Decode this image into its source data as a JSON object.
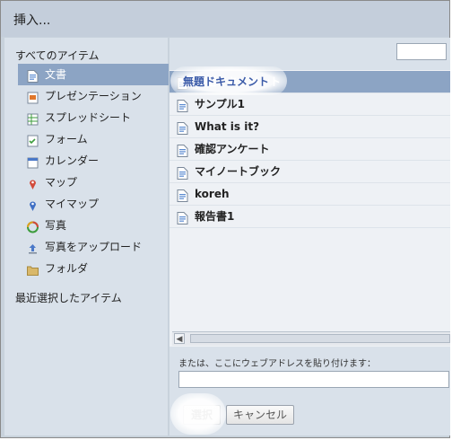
{
  "dialog": {
    "title": "挿入..."
  },
  "sidebar": {
    "all_items_heading": "すべてのアイテム",
    "items": [
      {
        "label": "文書",
        "icon": "document-icon",
        "color": "#5b8bd1"
      },
      {
        "label": "プレゼンテーション",
        "icon": "presentation-icon",
        "color": "#e0762a"
      },
      {
        "label": "スプレッドシート",
        "icon": "spreadsheet-icon",
        "color": "#3c9c3c"
      },
      {
        "label": "フォーム",
        "icon": "form-icon",
        "color": "#3c9c3c"
      },
      {
        "label": "カレンダー",
        "icon": "calendar-icon",
        "color": "#4a78c8"
      },
      {
        "label": "マップ",
        "icon": "map-pin-icon",
        "color": "#d24a3a"
      },
      {
        "label": "マイマップ",
        "icon": "my-map-pin-icon",
        "color": "#3f6fc4"
      },
      {
        "label": "写真",
        "icon": "photo-icon",
        "color": "#e0a020"
      },
      {
        "label": "写真をアップロード",
        "icon": "upload-icon",
        "color": "#4a78c8"
      },
      {
        "label": "フォルダ",
        "icon": "folder-icon",
        "color": "#d9b86a"
      }
    ],
    "recent_heading": "最近選択したアイテム"
  },
  "documents": [
    {
      "name": "無題ドキュメント",
      "selected": true
    },
    {
      "name": "サンプル1",
      "selected": false
    },
    {
      "name": "What is it?",
      "selected": false
    },
    {
      "name": "確認アンケート",
      "selected": false
    },
    {
      "name": "マイノートブック",
      "selected": false
    },
    {
      "name": "koreh",
      "selected": false
    },
    {
      "name": "報告書1",
      "selected": false
    }
  ],
  "url": {
    "label": "または、ここにウェブアドレスを貼り付けます：",
    "value": ""
  },
  "buttons": {
    "select": "選択",
    "cancel": "キャンセル"
  },
  "colors": {
    "selection": "#8ca4c4",
    "sidebar_bg": "#d9e1ea"
  }
}
